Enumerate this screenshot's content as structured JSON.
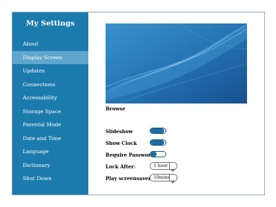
{
  "sidebar": {
    "title": "My Settings",
    "items": [
      {
        "label": "About",
        "active": false
      },
      {
        "label": "Display Screen",
        "active": true
      },
      {
        "label": "Updates",
        "active": false
      },
      {
        "label": "Connections",
        "active": false
      },
      {
        "label": "Accessability",
        "active": false
      },
      {
        "label": "Storage Space",
        "active": false
      },
      {
        "label": "Parental Mode",
        "active": false
      },
      {
        "label": "Date and Time",
        "active": false
      },
      {
        "label": "Language",
        "active": false
      },
      {
        "label": "Dictionary",
        "active": false
      },
      {
        "label": "Shut Down",
        "active": false
      }
    ]
  },
  "main": {
    "browse_label": "Browse",
    "settings": {
      "slideshow": {
        "label": "Slideshow",
        "on": true
      },
      "show_clock": {
        "label": "Show Clock",
        "on": true
      },
      "require_password": {
        "label": "Require Password",
        "on": false
      },
      "lock_after": {
        "label": "Lock After:",
        "value": "1 hour"
      },
      "play_screensaver": {
        "label": "Play screensaver",
        "value": "10mins"
      }
    }
  },
  "colors": {
    "sidebar_bg": "#1c7bad",
    "active_item_bg": "#5fa5cd",
    "toggle_color": "#1c6fa3"
  }
}
